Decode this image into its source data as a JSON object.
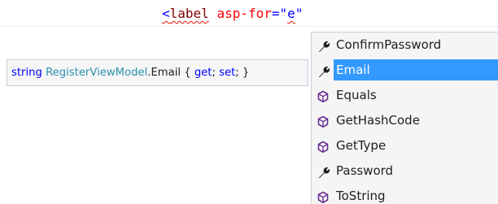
{
  "editor": {
    "code": {
      "open": "<",
      "tag": "label",
      "space": " ",
      "attr": "asp-for",
      "eq_quote": "=\"",
      "typed": "e",
      "close_quote": "\""
    }
  },
  "quick_info": {
    "type_kw": "string",
    "class_name": "RegisterViewModel",
    "member": ".Email { ",
    "get_kw": "get",
    "sep": "; ",
    "set_kw": "set",
    "end": "; }"
  },
  "completion": {
    "selected_index": 1,
    "items": [
      {
        "label": "ConfirmPassword",
        "icon": "wrench-icon"
      },
      {
        "label": "Email",
        "icon": "wrench-icon"
      },
      {
        "label": "Equals",
        "icon": "method-cube-icon"
      },
      {
        "label": "GetHashCode",
        "icon": "method-cube-icon"
      },
      {
        "label": "GetType",
        "icon": "method-cube-icon"
      },
      {
        "label": "Password",
        "icon": "wrench-icon"
      },
      {
        "label": "ToString",
        "icon": "method-cube-icon"
      }
    ]
  },
  "colors": {
    "selection": "#3399ff",
    "method_icon": "#652d90",
    "keyword": "#0000ff",
    "type_name": "#2b91af"
  }
}
